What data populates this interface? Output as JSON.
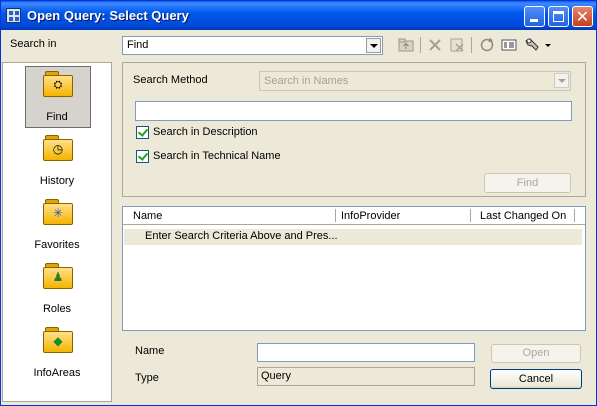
{
  "window": {
    "title": "Open Query: Select Query"
  },
  "search_in": {
    "label": "Search in",
    "value": "Find"
  },
  "toolbar": {
    "icons": [
      "folder-up-icon",
      "delete-icon",
      "delete-entry-icon",
      "refresh-icon",
      "details-view-icon",
      "tools-dropdown-icon"
    ]
  },
  "nav": {
    "items": [
      {
        "label": "Find",
        "icon": "binoculars-folder-icon",
        "selected": true
      },
      {
        "label": "History",
        "icon": "clock-folder-icon",
        "selected": false
      },
      {
        "label": "Favorites",
        "icon": "star-folder-icon",
        "selected": false
      },
      {
        "label": "Roles",
        "icon": "person-folder-icon",
        "selected": false
      },
      {
        "label": "InfoAreas",
        "icon": "diamond-folder-icon",
        "selected": false
      }
    ]
  },
  "search": {
    "method_label": "Search Method",
    "method_value": "Search in Names",
    "term_value": "",
    "desc_label": "Search in Description",
    "desc_checked": true,
    "tech_label": "Search in Technical Name",
    "tech_checked": true,
    "find_button": "Find"
  },
  "results": {
    "columns": [
      "Name",
      "InfoProvider",
      "Last Changed On"
    ],
    "rows": [
      [
        "Enter Search Criteria Above and Pres...",
        "",
        ""
      ]
    ]
  },
  "bottom": {
    "name_label": "Name",
    "name_value": "",
    "type_label": "Type",
    "type_value": "Query",
    "open_button": "Open",
    "cancel_button": "Cancel"
  },
  "colors": {
    "titlebar": "#0058ee",
    "dialog_bg": "#ece9d8",
    "folder": "#f4b400"
  }
}
